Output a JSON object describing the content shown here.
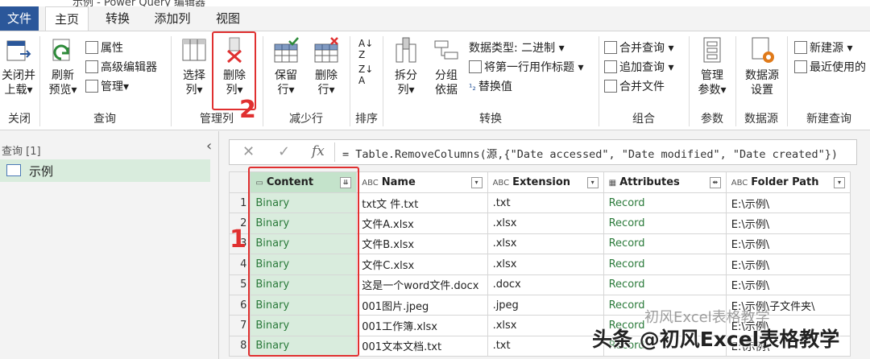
{
  "window": {
    "title": "示例 - Power Query 编辑器"
  },
  "tabs": {
    "file": "文件",
    "home": "主页",
    "transform": "转换",
    "addcol": "添加列",
    "view": "视图"
  },
  "ribbon": {
    "close": {
      "line1": "关闭并",
      "line2": "上载▾",
      "group": "关闭"
    },
    "query": {
      "refresh1": "刷新",
      "refresh2": "预览▾",
      "properties": "属性",
      "advanced": "高级编辑器",
      "manage": "管理▾",
      "group": "查询"
    },
    "managecols": {
      "choose1": "选择",
      "choose2": "列▾",
      "remove1": "删除",
      "remove2": "列▾",
      "group": "管理列"
    },
    "reducerows": {
      "keep1": "保留",
      "keep2": "行▾",
      "removerows1": "删除",
      "removerows2": "行▾",
      "group": "减少行"
    },
    "sort": {
      "group": "排序"
    },
    "transform": {
      "split1": "拆分",
      "split2": "列▾",
      "groupby1": "分组",
      "groupby2": "依据",
      "datatype": "数据类型: 二进制 ▾",
      "firstrow": "将第一行用作标题 ▾",
      "replace": "替换值",
      "group": "转换"
    },
    "combine": {
      "merge": "合并查询 ▾",
      "append": "追加查询 ▾",
      "combinefiles": "合并文件",
      "group": "组合"
    },
    "params": {
      "manage1": "管理",
      "manage2": "参数▾",
      "group": "参数"
    },
    "datasource": {
      "settings1": "数据源",
      "settings2": "设置",
      "group": "数据源"
    },
    "newquery": {
      "newsource": "新建源 ▾",
      "recent": "最近使用的",
      "group": "新建查询"
    }
  },
  "annotations": {
    "one": "1",
    "two": "2"
  },
  "querypane": {
    "header": "查询 [1]",
    "item": "示例"
  },
  "formula": "= Table.RemoveColumns(源,{\"Date accessed\", \"Date modified\", \"Date created\"})",
  "table": {
    "columns": [
      {
        "type": "",
        "name": "Content"
      },
      {
        "type": "ABC",
        "name": "Name"
      },
      {
        "type": "ABC",
        "name": "Extension"
      },
      {
        "type": "",
        "name": "Attributes"
      },
      {
        "type": "ABC",
        "name": "Folder Path"
      }
    ],
    "rows": [
      {
        "n": "1",
        "content": "Binary",
        "name": "txt文 件.txt",
        "ext": ".txt",
        "attr": "Record",
        "path": "E:\\示例\\"
      },
      {
        "n": "2",
        "content": "Binary",
        "name": "文件A.xlsx",
        "ext": ".xlsx",
        "attr": "Record",
        "path": "E:\\示例\\"
      },
      {
        "n": "3",
        "content": "Binary",
        "name": "文件B.xlsx",
        "ext": ".xlsx",
        "attr": "Record",
        "path": "E:\\示例\\"
      },
      {
        "n": "4",
        "content": "Binary",
        "name": "文件C.xlsx",
        "ext": ".xlsx",
        "attr": "Record",
        "path": "E:\\示例\\"
      },
      {
        "n": "5",
        "content": "Binary",
        "name": "这是一个word文件.docx",
        "ext": ".docx",
        "attr": "Record",
        "path": "E:\\示例\\"
      },
      {
        "n": "6",
        "content": "Binary",
        "name": "001图片.jpeg",
        "ext": ".jpeg",
        "attr": "Record",
        "path": "E:\\示例\\子文件夹\\"
      },
      {
        "n": "7",
        "content": "Binary",
        "name": "001工作簿.xlsx",
        "ext": ".xlsx",
        "attr": "Record",
        "path": "E:\\示例\\"
      },
      {
        "n": "8",
        "content": "Binary",
        "name": "001文本文档.txt",
        "ext": ".txt",
        "attr": "Record",
        "path": "E:\\示例\\"
      }
    ]
  },
  "watermark": {
    "small": "初风Excel表格教学",
    "big": "头条 @初风Excel表格教学"
  },
  "colors": {
    "file_tab": "#2b579a",
    "selected_col": "#d9ecdd",
    "annotation": "#e03030"
  }
}
